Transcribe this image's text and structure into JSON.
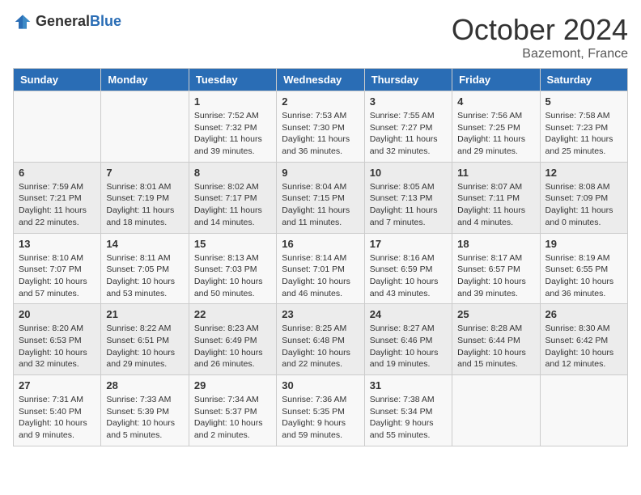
{
  "header": {
    "logo_general": "General",
    "logo_blue": "Blue",
    "title": "October 2024",
    "location": "Bazemont, France"
  },
  "calendar": {
    "weekdays": [
      "Sunday",
      "Monday",
      "Tuesday",
      "Wednesday",
      "Thursday",
      "Friday",
      "Saturday"
    ],
    "weeks": [
      [
        {
          "day": "",
          "sunrise": "",
          "sunset": "",
          "daylight": ""
        },
        {
          "day": "",
          "sunrise": "",
          "sunset": "",
          "daylight": ""
        },
        {
          "day": "1",
          "sunrise": "Sunrise: 7:52 AM",
          "sunset": "Sunset: 7:32 PM",
          "daylight": "Daylight: 11 hours and 39 minutes."
        },
        {
          "day": "2",
          "sunrise": "Sunrise: 7:53 AM",
          "sunset": "Sunset: 7:30 PM",
          "daylight": "Daylight: 11 hours and 36 minutes."
        },
        {
          "day": "3",
          "sunrise": "Sunrise: 7:55 AM",
          "sunset": "Sunset: 7:27 PM",
          "daylight": "Daylight: 11 hours and 32 minutes."
        },
        {
          "day": "4",
          "sunrise": "Sunrise: 7:56 AM",
          "sunset": "Sunset: 7:25 PM",
          "daylight": "Daylight: 11 hours and 29 minutes."
        },
        {
          "day": "5",
          "sunrise": "Sunrise: 7:58 AM",
          "sunset": "Sunset: 7:23 PM",
          "daylight": "Daylight: 11 hours and 25 minutes."
        }
      ],
      [
        {
          "day": "6",
          "sunrise": "Sunrise: 7:59 AM",
          "sunset": "Sunset: 7:21 PM",
          "daylight": "Daylight: 11 hours and 22 minutes."
        },
        {
          "day": "7",
          "sunrise": "Sunrise: 8:01 AM",
          "sunset": "Sunset: 7:19 PM",
          "daylight": "Daylight: 11 hours and 18 minutes."
        },
        {
          "day": "8",
          "sunrise": "Sunrise: 8:02 AM",
          "sunset": "Sunset: 7:17 PM",
          "daylight": "Daylight: 11 hours and 14 minutes."
        },
        {
          "day": "9",
          "sunrise": "Sunrise: 8:04 AM",
          "sunset": "Sunset: 7:15 PM",
          "daylight": "Daylight: 11 hours and 11 minutes."
        },
        {
          "day": "10",
          "sunrise": "Sunrise: 8:05 AM",
          "sunset": "Sunset: 7:13 PM",
          "daylight": "Daylight: 11 hours and 7 minutes."
        },
        {
          "day": "11",
          "sunrise": "Sunrise: 8:07 AM",
          "sunset": "Sunset: 7:11 PM",
          "daylight": "Daylight: 11 hours and 4 minutes."
        },
        {
          "day": "12",
          "sunrise": "Sunrise: 8:08 AM",
          "sunset": "Sunset: 7:09 PM",
          "daylight": "Daylight: 11 hours and 0 minutes."
        }
      ],
      [
        {
          "day": "13",
          "sunrise": "Sunrise: 8:10 AM",
          "sunset": "Sunset: 7:07 PM",
          "daylight": "Daylight: 10 hours and 57 minutes."
        },
        {
          "day": "14",
          "sunrise": "Sunrise: 8:11 AM",
          "sunset": "Sunset: 7:05 PM",
          "daylight": "Daylight: 10 hours and 53 minutes."
        },
        {
          "day": "15",
          "sunrise": "Sunrise: 8:13 AM",
          "sunset": "Sunset: 7:03 PM",
          "daylight": "Daylight: 10 hours and 50 minutes."
        },
        {
          "day": "16",
          "sunrise": "Sunrise: 8:14 AM",
          "sunset": "Sunset: 7:01 PM",
          "daylight": "Daylight: 10 hours and 46 minutes."
        },
        {
          "day": "17",
          "sunrise": "Sunrise: 8:16 AM",
          "sunset": "Sunset: 6:59 PM",
          "daylight": "Daylight: 10 hours and 43 minutes."
        },
        {
          "day": "18",
          "sunrise": "Sunrise: 8:17 AM",
          "sunset": "Sunset: 6:57 PM",
          "daylight": "Daylight: 10 hours and 39 minutes."
        },
        {
          "day": "19",
          "sunrise": "Sunrise: 8:19 AM",
          "sunset": "Sunset: 6:55 PM",
          "daylight": "Daylight: 10 hours and 36 minutes."
        }
      ],
      [
        {
          "day": "20",
          "sunrise": "Sunrise: 8:20 AM",
          "sunset": "Sunset: 6:53 PM",
          "daylight": "Daylight: 10 hours and 32 minutes."
        },
        {
          "day": "21",
          "sunrise": "Sunrise: 8:22 AM",
          "sunset": "Sunset: 6:51 PM",
          "daylight": "Daylight: 10 hours and 29 minutes."
        },
        {
          "day": "22",
          "sunrise": "Sunrise: 8:23 AM",
          "sunset": "Sunset: 6:49 PM",
          "daylight": "Daylight: 10 hours and 26 minutes."
        },
        {
          "day": "23",
          "sunrise": "Sunrise: 8:25 AM",
          "sunset": "Sunset: 6:48 PM",
          "daylight": "Daylight: 10 hours and 22 minutes."
        },
        {
          "day": "24",
          "sunrise": "Sunrise: 8:27 AM",
          "sunset": "Sunset: 6:46 PM",
          "daylight": "Daylight: 10 hours and 19 minutes."
        },
        {
          "day": "25",
          "sunrise": "Sunrise: 8:28 AM",
          "sunset": "Sunset: 6:44 PM",
          "daylight": "Daylight: 10 hours and 15 minutes."
        },
        {
          "day": "26",
          "sunrise": "Sunrise: 8:30 AM",
          "sunset": "Sunset: 6:42 PM",
          "daylight": "Daylight: 10 hours and 12 minutes."
        }
      ],
      [
        {
          "day": "27",
          "sunrise": "Sunrise: 7:31 AM",
          "sunset": "Sunset: 5:40 PM",
          "daylight": "Daylight: 10 hours and 9 minutes."
        },
        {
          "day": "28",
          "sunrise": "Sunrise: 7:33 AM",
          "sunset": "Sunset: 5:39 PM",
          "daylight": "Daylight: 10 hours and 5 minutes."
        },
        {
          "day": "29",
          "sunrise": "Sunrise: 7:34 AM",
          "sunset": "Sunset: 5:37 PM",
          "daylight": "Daylight: 10 hours and 2 minutes."
        },
        {
          "day": "30",
          "sunrise": "Sunrise: 7:36 AM",
          "sunset": "Sunset: 5:35 PM",
          "daylight": "Daylight: 9 hours and 59 minutes."
        },
        {
          "day": "31",
          "sunrise": "Sunrise: 7:38 AM",
          "sunset": "Sunset: 5:34 PM",
          "daylight": "Daylight: 9 hours and 55 minutes."
        },
        {
          "day": "",
          "sunrise": "",
          "sunset": "",
          "daylight": ""
        },
        {
          "day": "",
          "sunrise": "",
          "sunset": "",
          "daylight": ""
        }
      ]
    ]
  }
}
